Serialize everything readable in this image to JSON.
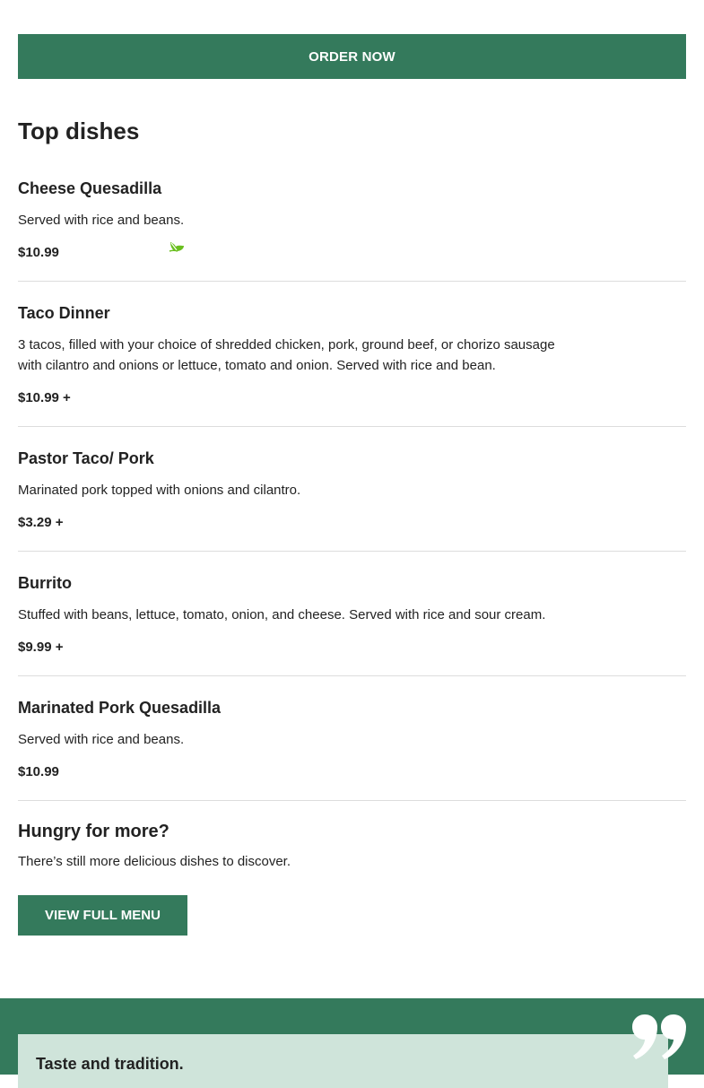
{
  "order_button": {
    "label": "ORDER NOW"
  },
  "section_title": "Top dishes",
  "dishes": [
    {
      "name": "Cheese Quesadilla",
      "description": "Served with rice and beans.",
      "price": "$10.99",
      "icon": "vegetarian-leaf-icon"
    },
    {
      "name": "Taco Dinner",
      "description": "3 tacos, filled with your choice of shredded chicken, pork, ground beef, or chorizo sausage with cilantro and onions or lettuce, tomato and onion. Served with rice and bean.",
      "price": "$10.99 +"
    },
    {
      "name": "Pastor Taco/ Pork",
      "description": "Marinated pork topped with onions and cilantro.",
      "price": "$3.29 +"
    },
    {
      "name": "Burrito",
      "description": "Stuffed with beans, lettuce, tomato, onion, and cheese. Served with rice and sour cream.",
      "price": "$9.99 +"
    },
    {
      "name": "Marinated Pork Quesadilla",
      "description": "Served with rice and beans.",
      "price": "$10.99"
    }
  ],
  "more": {
    "title": "Hungry for more?",
    "text": "There’s still more delicious dishes to discover.",
    "button_label": "VIEW FULL MENU"
  },
  "testimonial": {
    "title": "Taste and tradition.",
    "icon": "quote-icon"
  },
  "colors": {
    "accent": "#347a5c",
    "card_bg": "#cfe4da",
    "veg_icon": "#6abf1f"
  }
}
